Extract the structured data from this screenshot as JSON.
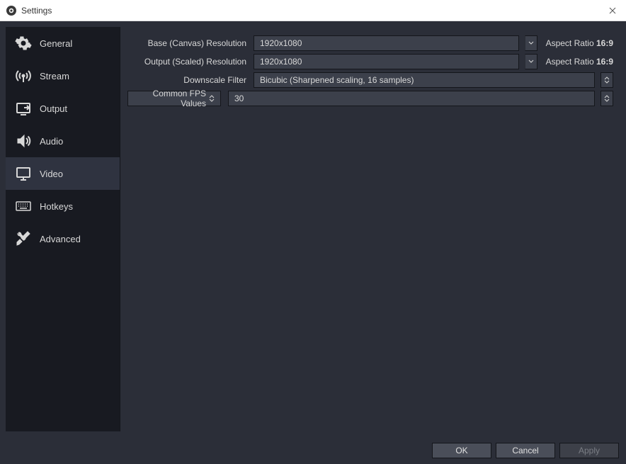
{
  "window": {
    "title": "Settings"
  },
  "sidebar": {
    "items": [
      {
        "label": "General"
      },
      {
        "label": "Stream"
      },
      {
        "label": "Output"
      },
      {
        "label": "Audio"
      },
      {
        "label": "Video"
      },
      {
        "label": "Hotkeys"
      },
      {
        "label": "Advanced"
      }
    ],
    "selected_index": 4
  },
  "video": {
    "base_label": "Base (Canvas) Resolution",
    "base_value": "1920x1080",
    "output_label": "Output (Scaled) Resolution",
    "output_value": "1920x1080",
    "aspect_label": "Aspect Ratio",
    "aspect_value": "16:9",
    "downscale_label": "Downscale Filter",
    "downscale_value": "Bicubic (Sharpened scaling, 16 samples)",
    "fps_type_label": "Common FPS Values",
    "fps_value": "30"
  },
  "footer": {
    "ok": "OK",
    "cancel": "Cancel",
    "apply": "Apply"
  }
}
